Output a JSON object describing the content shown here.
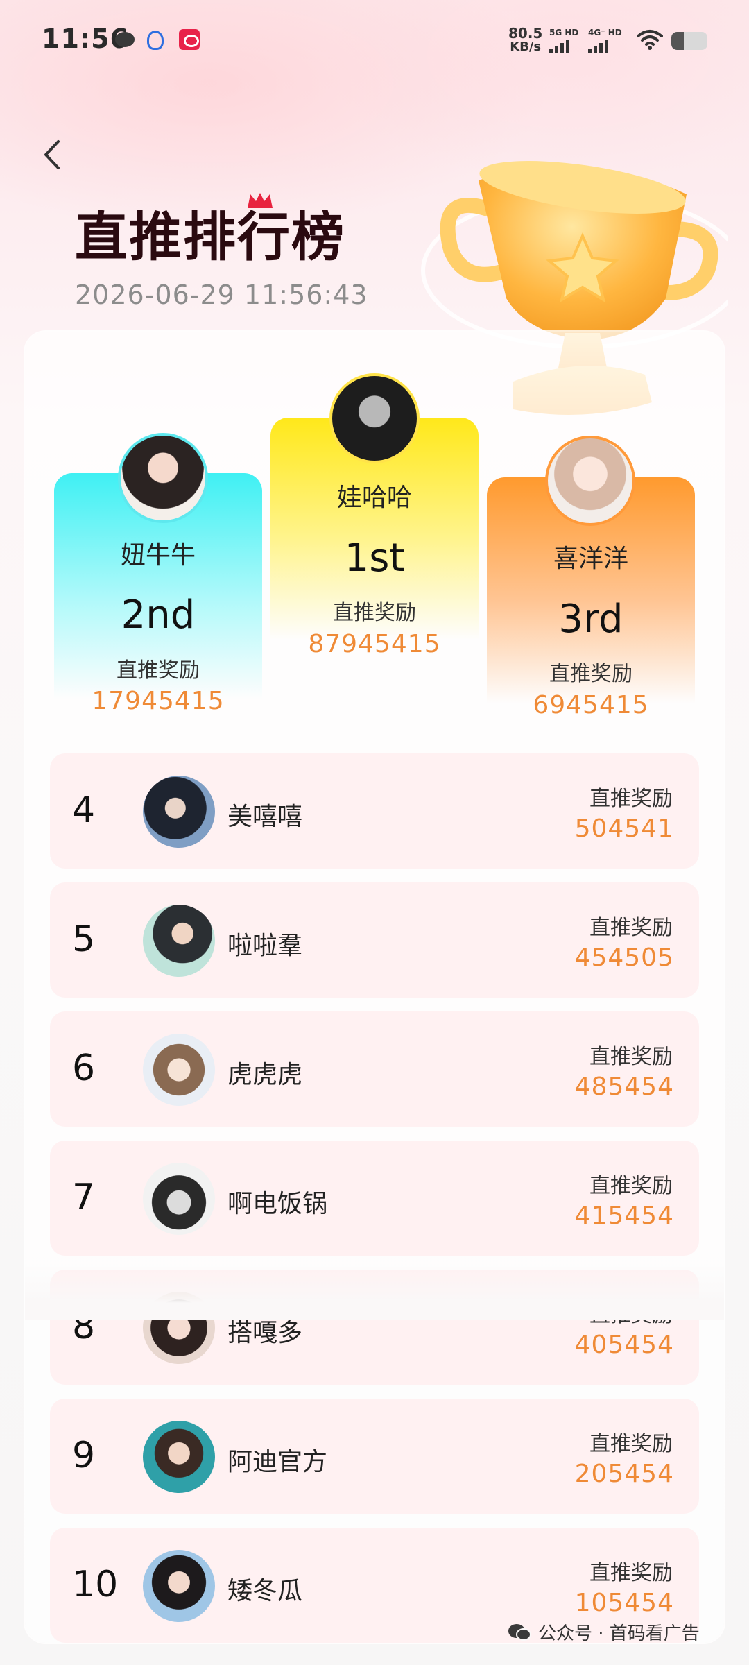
{
  "status_bar": {
    "time": "11:56",
    "net_speed": "80.5",
    "net_unit": "KB/s",
    "sim1": "5G HD",
    "sim2": "4G⁺ HD",
    "battery_level": 0.35
  },
  "header": {
    "title": "直推排行榜",
    "datetime": "2026-06-29 11:56:43"
  },
  "podium": [
    {
      "rank": "2nd",
      "name": "妞牛牛",
      "label": "直推奖励",
      "value": "17945415",
      "color": "#3ff0f3"
    },
    {
      "rank": "1st",
      "name": "娃哈哈",
      "label": "直推奖励",
      "value": "87945415",
      "color": "#ffe81a"
    },
    {
      "rank": "3rd",
      "name": "喜洋洋",
      "label": "直推奖励",
      "value": "6945415",
      "color": "#ff9a2e"
    }
  ],
  "list": [
    {
      "rank": "4",
      "name": "美嘻嘻",
      "label": "直推奖励",
      "value": "504541"
    },
    {
      "rank": "5",
      "name": "啦啦羣",
      "label": "直推奖励",
      "value": "454505"
    },
    {
      "rank": "6",
      "name": "虎虎虎",
      "label": "直推奖励",
      "value": "485454"
    },
    {
      "rank": "7",
      "name": "啊电饭锅",
      "label": "直推奖励",
      "value": "415454"
    },
    {
      "rank": "8",
      "name": "搭嘎多",
      "label": "直推奖励",
      "value": "405454"
    },
    {
      "rank": "9",
      "name": "阿迪官方",
      "label": "直推奖励",
      "value": "205454"
    },
    {
      "rank": "10",
      "name": "矮冬瓜",
      "label": "直推奖励",
      "value": "105454"
    }
  ],
  "watermark": {
    "text": "公众号 · 首码看广告"
  },
  "colors": {
    "accent_orange": "#ef8a36",
    "row_bg": "#fff1f2"
  }
}
